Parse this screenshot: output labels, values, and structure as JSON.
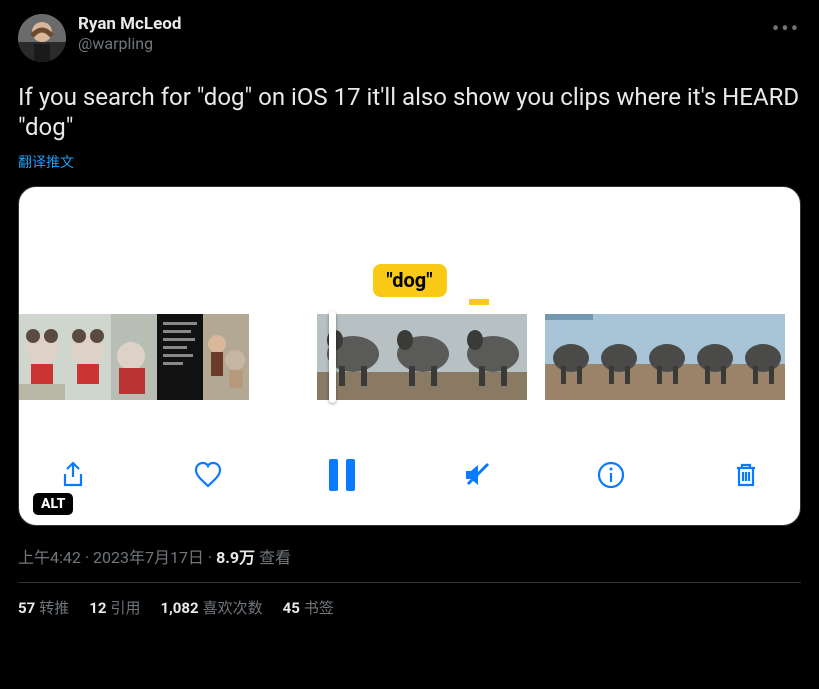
{
  "author": {
    "display_name": "Ryan McLeod",
    "handle": "@warpling"
  },
  "tweet_text": "If you search for \"dog\" on iOS 17 it'll also show you clips where it's HEARD \"dog\"",
  "translate_label": "翻译推文",
  "media": {
    "search_badge": "\"dog\"",
    "alt_label": "ALT"
  },
  "meta": {
    "time": "上午4:42",
    "date": "2023年7月17日",
    "views_count": "8.9万",
    "views_label": "查看",
    "sep": " · "
  },
  "stats": {
    "retweets_count": "57",
    "retweets_label": "转推",
    "quotes_count": "12",
    "quotes_label": "引用",
    "likes_count": "1,082",
    "likes_label": "喜欢次数",
    "bookmarks_count": "45",
    "bookmarks_label": "书签"
  }
}
